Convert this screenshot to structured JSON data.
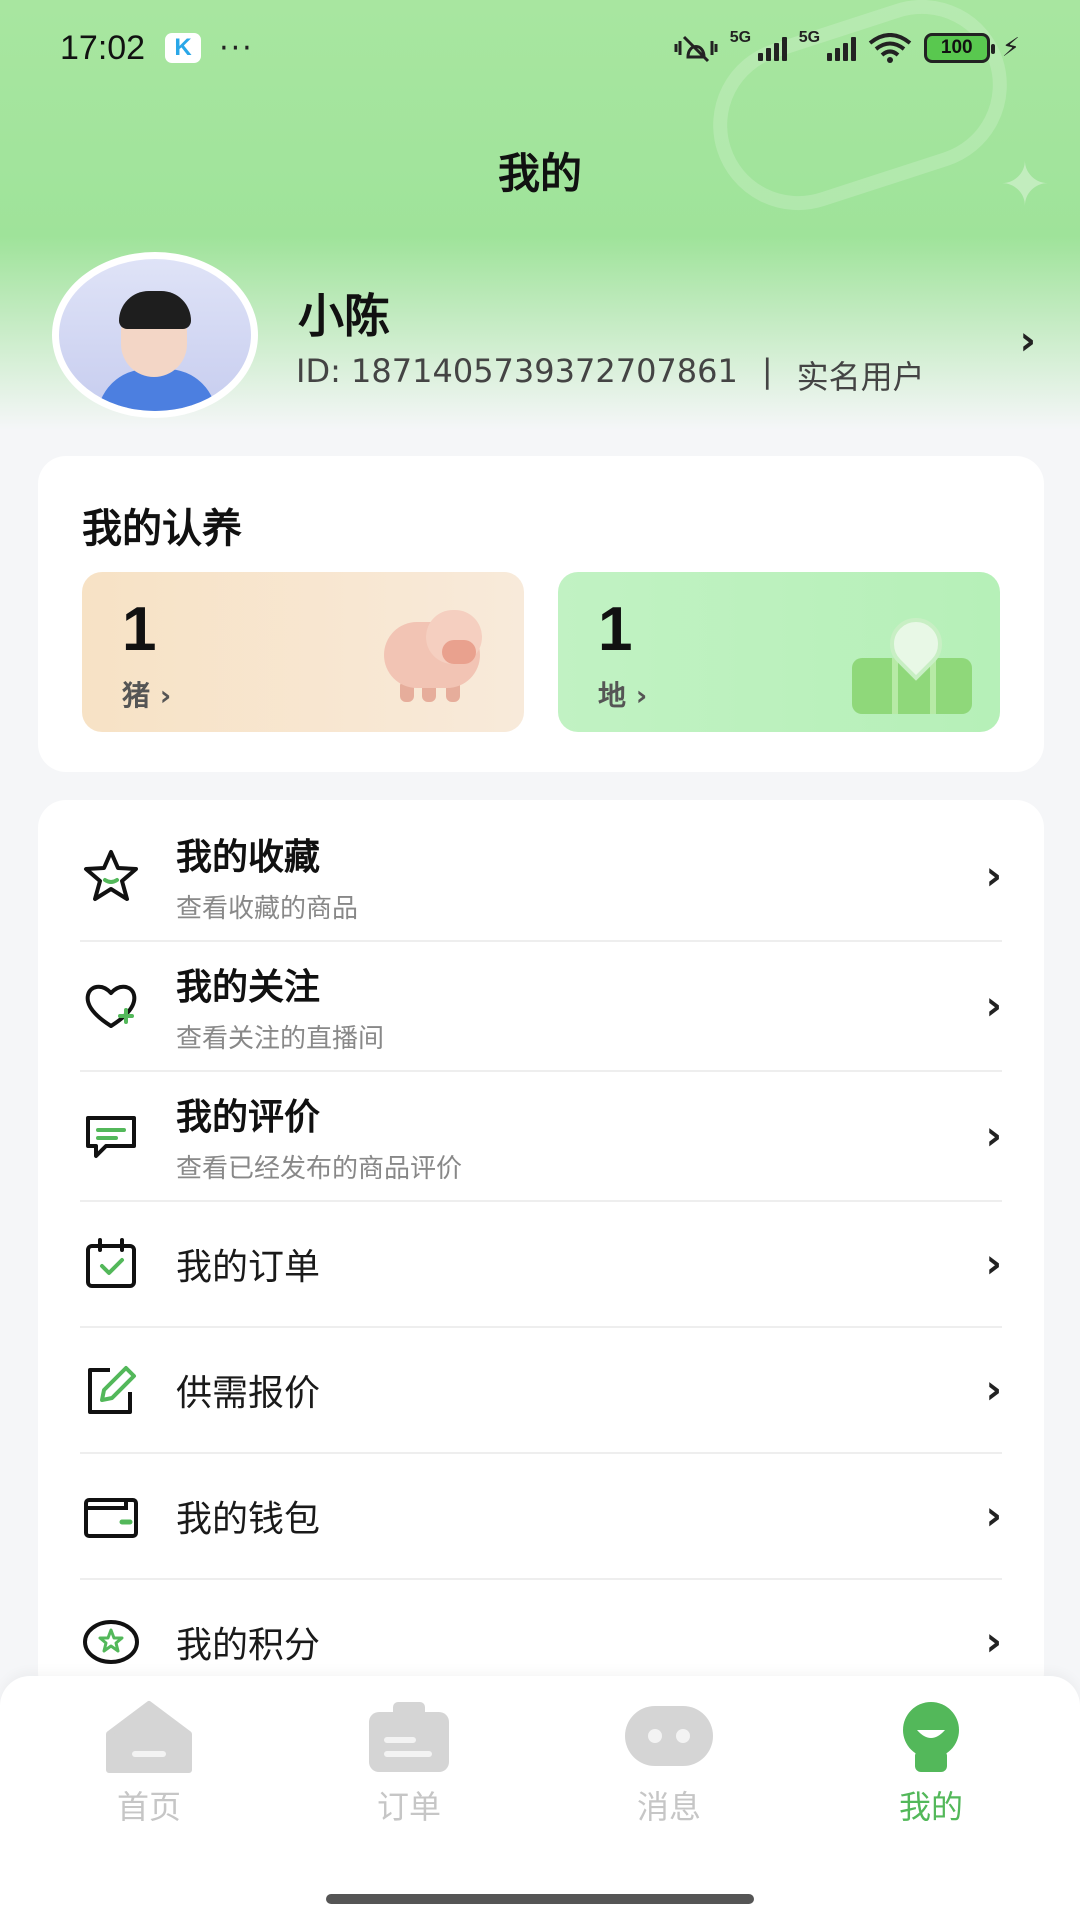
{
  "status_bar": {
    "time": "17:02",
    "app_badge": "K",
    "more": "···",
    "network_1": "5G",
    "network_2": "5G",
    "battery": "100"
  },
  "page": {
    "title": "我的"
  },
  "profile": {
    "name": "小陈",
    "id_text": "ID: 1871405739372707861",
    "separator": "|",
    "verify_status": "实名用户"
  },
  "adoption": {
    "title": "我的认养",
    "items": [
      {
        "count": "1",
        "label": "猪 ›"
      },
      {
        "count": "1",
        "label": "地 ›"
      }
    ]
  },
  "menu": {
    "items": [
      {
        "title": "我的收藏",
        "subtitle": "查看收藏的商品",
        "icon": "star-icon"
      },
      {
        "title": "我的关注",
        "subtitle": "查看关注的直播间",
        "icon": "heart-icon"
      },
      {
        "title": "我的评价",
        "subtitle": "查看已经发布的商品评价",
        "icon": "comment-icon"
      },
      {
        "title": "我的订单",
        "icon": "calendar-check-icon"
      },
      {
        "title": "供需报价",
        "icon": "edit-icon"
      },
      {
        "title": "我的钱包",
        "icon": "wallet-icon"
      },
      {
        "title": "我的积分",
        "icon": "points-star-icon"
      }
    ],
    "arrow": "›"
  },
  "tabbar": {
    "tabs": [
      {
        "label": "首页",
        "icon": "home-icon",
        "active": false
      },
      {
        "label": "订单",
        "icon": "order-icon",
        "active": false
      },
      {
        "label": "消息",
        "icon": "message-icon",
        "active": false
      },
      {
        "label": "我的",
        "icon": "profile-icon",
        "active": true
      }
    ]
  },
  "colors": {
    "accent_green": "#53b85a",
    "header_green": "#a8e6a0",
    "pig_tile": "#f7e2c5",
    "land_tile": "#c1f2c3"
  }
}
